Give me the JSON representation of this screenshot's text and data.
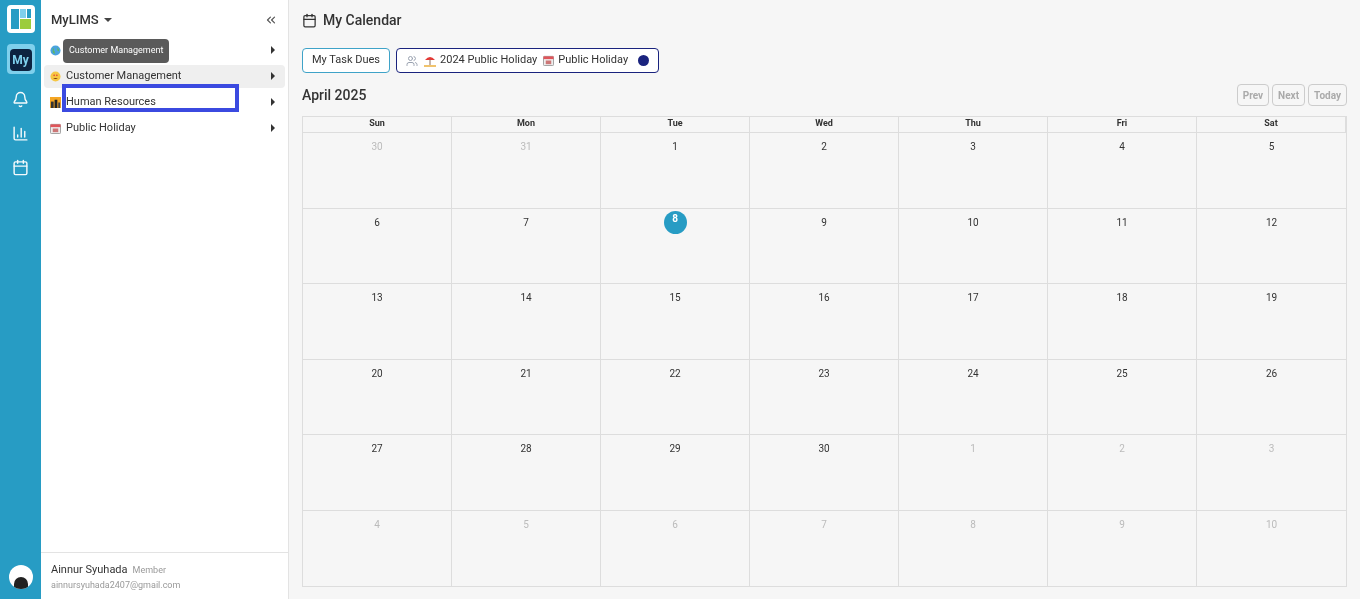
{
  "rail": {
    "items": [
      {
        "kind": "my",
        "label": "My"
      },
      {
        "kind": "bell"
      },
      {
        "kind": "chart"
      },
      {
        "kind": "calendar"
      }
    ]
  },
  "sidebar": {
    "title": "MyLIMS",
    "items": [
      {
        "selected": false
      },
      {
        "label": "Customer Management",
        "selected": true
      },
      {
        "label": "Human Resources",
        "selected": false
      },
      {
        "label": "Public Holiday",
        "selected": false
      }
    ],
    "tooltip": "Customer Management",
    "user": {
      "name": "Ainnur Syuhada",
      "role": "Member",
      "email": "ainnursyuhada2407@gmail.com"
    }
  },
  "page": {
    "title": "My Calendar"
  },
  "filters": {
    "task_button": "My Task Dues",
    "tags": [
      {
        "label": "2024 Public Holiday"
      },
      {
        "label": "Public Holiday"
      }
    ]
  },
  "calendar": {
    "month": "April 2025",
    "nav": [
      {
        "label": "Prev",
        "disabled": true
      },
      {
        "label": "Next",
        "disabled": true
      },
      {
        "label": "Today",
        "disabled": true
      }
    ],
    "weekdays": [
      "Sun",
      "Mon",
      "Tue",
      "Wed",
      "Thu",
      "Fri",
      "Sat"
    ],
    "weeks": [
      [
        {
          "day": "30",
          "outside": true,
          "selected": false
        },
        {
          "day": "31",
          "outside": true,
          "selected": false
        },
        {
          "day": "1",
          "outside": false,
          "selected": false
        },
        {
          "day": "2",
          "outside": false,
          "selected": false
        },
        {
          "day": "3",
          "outside": false,
          "selected": false
        },
        {
          "day": "4",
          "outside": false,
          "selected": false
        },
        {
          "day": "5",
          "outside": false,
          "selected": false
        }
      ],
      [
        {
          "day": "6",
          "outside": false,
          "selected": false
        },
        {
          "day": "7",
          "outside": false,
          "selected": false
        },
        {
          "day": "8",
          "outside": false,
          "selected": true
        },
        {
          "day": "9",
          "outside": false,
          "selected": false
        },
        {
          "day": "10",
          "outside": false,
          "selected": false
        },
        {
          "day": "11",
          "outside": false,
          "selected": false
        },
        {
          "day": "12",
          "outside": false,
          "selected": false
        }
      ],
      [
        {
          "day": "13",
          "outside": false,
          "selected": false
        },
        {
          "day": "14",
          "outside": false,
          "selected": false
        },
        {
          "day": "15",
          "outside": false,
          "selected": false
        },
        {
          "day": "16",
          "outside": false,
          "selected": false
        },
        {
          "day": "17",
          "outside": false,
          "selected": false
        },
        {
          "day": "18",
          "outside": false,
          "selected": false
        },
        {
          "day": "19",
          "outside": false,
          "selected": false
        }
      ],
      [
        {
          "day": "20",
          "outside": false,
          "selected": false
        },
        {
          "day": "21",
          "outside": false,
          "selected": false
        },
        {
          "day": "22",
          "outside": false,
          "selected": false
        },
        {
          "day": "23",
          "outside": false,
          "selected": false
        },
        {
          "day": "24",
          "outside": false,
          "selected": false
        },
        {
          "day": "25",
          "outside": false,
          "selected": false
        },
        {
          "day": "26",
          "outside": false,
          "selected": false
        }
      ],
      [
        {
          "day": "27",
          "outside": false,
          "selected": false
        },
        {
          "day": "28",
          "outside": false,
          "selected": false
        },
        {
          "day": "29",
          "outside": false,
          "selected": false
        },
        {
          "day": "30",
          "outside": false,
          "selected": false
        },
        {
          "day": "1",
          "outside": true,
          "selected": false
        },
        {
          "day": "2",
          "outside": true,
          "selected": false
        },
        {
          "day": "3",
          "outside": true,
          "selected": false
        }
      ],
      [
        {
          "day": "4",
          "outside": true,
          "selected": false
        },
        {
          "day": "5",
          "outside": true,
          "selected": false
        },
        {
          "day": "6",
          "outside": true,
          "selected": false
        },
        {
          "day": "7",
          "outside": true,
          "selected": false
        },
        {
          "day": "8",
          "outside": true,
          "selected": false
        },
        {
          "day": "9",
          "outside": true,
          "selected": false
        },
        {
          "day": "10",
          "outside": true,
          "selected": false
        }
      ]
    ]
  }
}
